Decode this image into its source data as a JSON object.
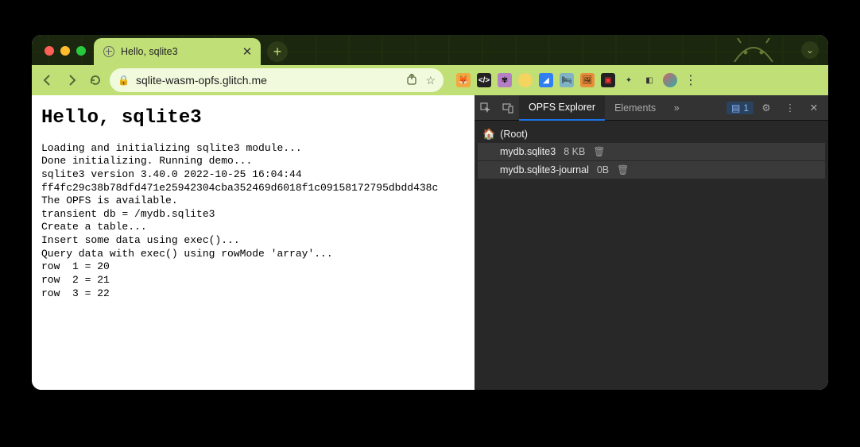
{
  "browser": {
    "tab_title": "Hello, sqlite3",
    "new_tab_tooltip": "+",
    "url_display": "sqlite-wasm-opfs.glitch.me",
    "profile_chevron": "⌄"
  },
  "page": {
    "heading": "Hello, sqlite3",
    "lines": [
      "Loading and initializing sqlite3 module...",
      "Done initializing. Running demo...",
      "sqlite3 version 3.40.0 2022-10-25 16:04:44",
      "ff4fc29c38b78dfd471e25942304cba352469d6018f1c09158172795dbdd438c",
      "The OPFS is available.",
      "transient db = /mydb.sqlite3",
      "Create a table...",
      "Insert some data using exec()...",
      "Query data with exec() using rowMode 'array'...",
      "row  1 = 20",
      "row  2 = 21",
      "row  3 = 22"
    ]
  },
  "devtools": {
    "tabs": {
      "active": "OPFS Explorer",
      "other": "Elements",
      "overflow": "»"
    },
    "issues_badge_count": "1",
    "tree": {
      "root_label": "(Root)",
      "files": [
        {
          "name": "mydb.sqlite3",
          "size": "8 KB"
        },
        {
          "name": "mydb.sqlite3-journal",
          "size": "0B"
        }
      ]
    }
  },
  "extensions": {
    "labels": [
      "fox",
      "code",
      "squid",
      "circle",
      "flag",
      "bed",
      "pic",
      "rec",
      "puzzle",
      "panel",
      "avatar",
      "menu"
    ]
  }
}
